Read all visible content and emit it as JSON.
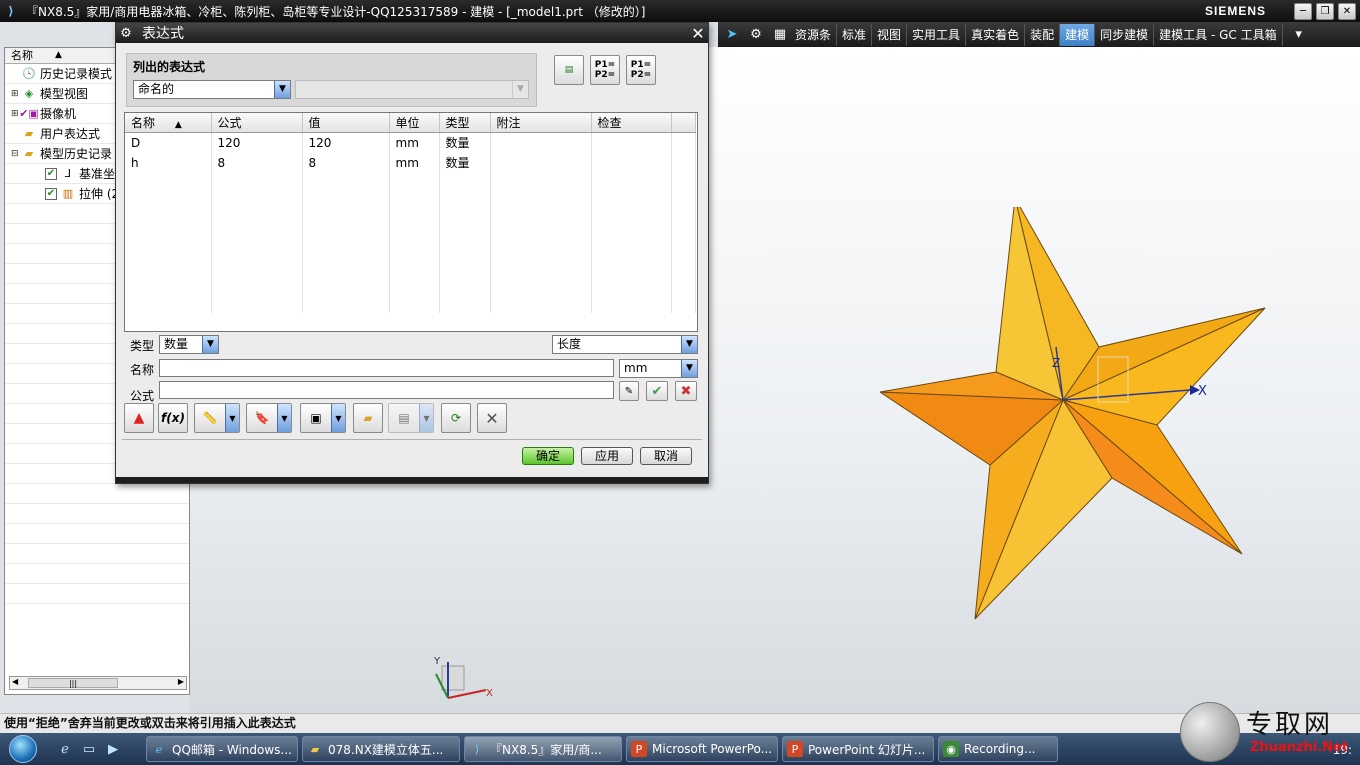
{
  "titlebar": {
    "title": "『NX8.5』家用/商用电器冰箱、冷柜、陈列柜、岛柜等专业设计-QQ125317589 - 建模 - [_model1.prt （修改的）]",
    "brand": "SIEMENS"
  },
  "toolbar": {
    "menus": [
      "资源条",
      "标准",
      "视图",
      "实用工具",
      "真实着色",
      "装配",
      "建模",
      "同步建模",
      "建模工具 - GC 工具箱"
    ],
    "active": "建模"
  },
  "navigator": {
    "header": "名称",
    "items": [
      {
        "label": "历史记录模式",
        "icon": "clock-icon"
      },
      {
        "label": "模型视图",
        "icon": "model-views-icon"
      },
      {
        "label": "摄像机",
        "icon": "camera-icon"
      },
      {
        "label": "用户表达式",
        "icon": "folder-icon"
      },
      {
        "label": "模型历史记录",
        "icon": "folder-icon"
      },
      {
        "label": "基准坐",
        "icon": "datum-csys-icon"
      },
      {
        "label": "拉伸 (2",
        "icon": "extrude-icon"
      }
    ]
  },
  "dialog": {
    "title": "表达式",
    "listed_label": "列出的表达式",
    "list_filter": "命名的",
    "list_filter_2": "",
    "columns": [
      "名称",
      "公式",
      "值",
      "单位",
      "类型",
      "附注",
      "检查"
    ],
    "rows": [
      [
        "D",
        "120",
        "120",
        "mm",
        "数量",
        "",
        ""
      ],
      [
        "h",
        "8",
        "8",
        "mm",
        "数量",
        "",
        ""
      ]
    ],
    "type_label": "类型",
    "type_value": "数量",
    "dimension_value": "长度",
    "name_label": "名称",
    "name_value": "",
    "unit_value": "mm",
    "formula_label": "公式",
    "formula_value": "",
    "fx_label": "f(x)",
    "ok_label": "确定",
    "apply_label": "应用",
    "cancel_label": "取消"
  },
  "axes": {
    "x": "X",
    "z": "Z",
    "triad_x": "X",
    "triad_y": "Y"
  },
  "status": "使用“拒绝”舍弃当前更改或双击来将引用插入此表达式",
  "taskbar": {
    "tasks": [
      "QQ邮箱 - Windows...",
      "078.NX建模立体五...",
      "『NX8.5』家用/商...",
      "Microsoft PowerPo...",
      "PowerPoint 幻灯片...",
      "Recording..."
    ],
    "clock": "19:"
  },
  "watermark": {
    "cn": "专取网",
    "url": "Zhuanzhi.Net"
  }
}
